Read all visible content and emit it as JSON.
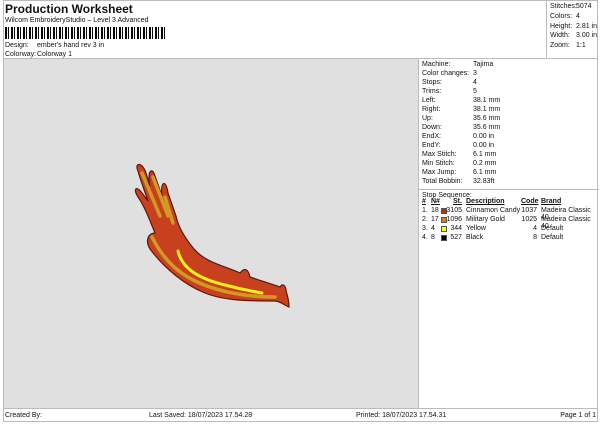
{
  "header": {
    "title": "Production Worksheet",
    "subtitle": "Wilcom EmbroideryStudio – Level 3 Advanced",
    "design_label": "Design:",
    "design": "ember's hand rev 3 in",
    "colorway_label": "Colorway:",
    "colorway": "Colorway 1"
  },
  "summary": [
    {
      "label": "Stitches:",
      "value": "5074"
    },
    {
      "label": "Colors:",
      "value": "4"
    },
    {
      "label": "Height:",
      "value": "2.81 in"
    },
    {
      "label": "Width:",
      "value": "3.00 in"
    },
    {
      "label": "Zoom:",
      "value": "1:1"
    }
  ],
  "details": [
    {
      "label": "Machine:",
      "value": "Tajima"
    },
    {
      "label": "Color changes:",
      "value": "3"
    },
    {
      "label": "Stops:",
      "value": "4"
    },
    {
      "label": "Trims:",
      "value": "5"
    },
    {
      "label": "Left:",
      "value": "38.1 mm"
    },
    {
      "label": "Right:",
      "value": "38.1 mm"
    },
    {
      "label": "Up:",
      "value": "35.6 mm"
    },
    {
      "label": "Down:",
      "value": "35.6 mm"
    },
    {
      "label": "EndX:",
      "value": "0.00 in"
    },
    {
      "label": "EndY:",
      "value": "0.00 in"
    },
    {
      "label": "Max Stitch:",
      "value": "6.1 mm"
    },
    {
      "label": "Min Stitch:",
      "value": "0.2 mm"
    },
    {
      "label": "Max Jump:",
      "value": "6.1 mm"
    },
    {
      "label": "Total Bobbin:",
      "value": "32.83ft"
    }
  ],
  "stop_sequence": {
    "title": "Stop Sequence:",
    "headers": {
      "num": "#",
      "n": "N#",
      "st": "St.",
      "desc": "Description",
      "code": "Code",
      "brand": "Brand"
    },
    "rows": [
      {
        "num": "1.",
        "n": "18",
        "color": "#c0281c",
        "st": "3105",
        "desc": "Cinnamon Candy",
        "code": "1037",
        "brand": "Madeira Classic 40"
      },
      {
        "num": "2.",
        "n": "17",
        "color": "#c8861c",
        "st": "1096",
        "desc": "Military Gold",
        "code": "1025",
        "brand": "Madeira Classic 40"
      },
      {
        "num": "3.",
        "n": "4",
        "color": "#ffff00",
        "st": "344",
        "desc": "Yellow",
        "code": "4",
        "brand": "Default"
      },
      {
        "num": "4.",
        "n": "8",
        "color": "#000000",
        "st": "527",
        "desc": "Black",
        "code": "8",
        "brand": "Default"
      }
    ]
  },
  "footer": {
    "created": "Created By:",
    "saved": "Last Saved: 18/07/2023 17.54.28",
    "printed": "Printed: 18/07/2023 17.54.31",
    "page": "Page 1 of 1"
  }
}
